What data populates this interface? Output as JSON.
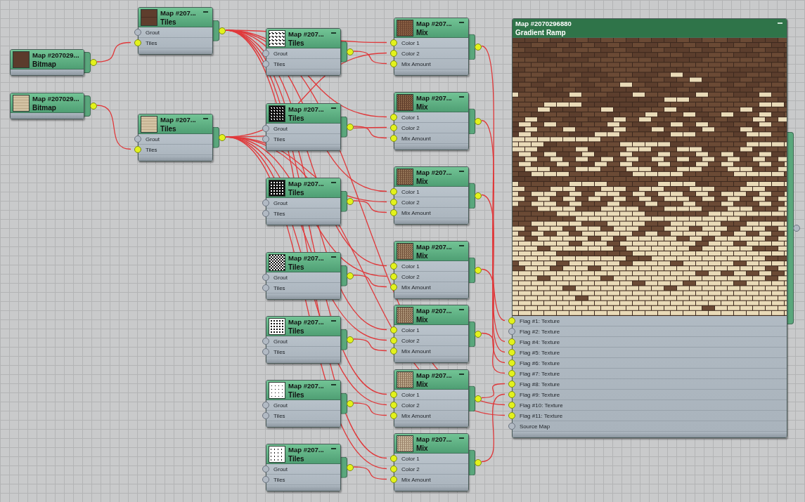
{
  "nodes": [
    {
      "kind": "bitmap",
      "title": "Map #207029...",
      "type": "Bitmap",
      "output_connected": true
    },
    {
      "kind": "bitmap",
      "title": "Map #207029...",
      "type": "Bitmap",
      "output_connected": true
    },
    {
      "kind": "tiles",
      "title": "Map #207...",
      "type": "Tiles",
      "inputs": [
        {
          "label": "Grout",
          "connected": false
        },
        {
          "label": "Tiles",
          "connected": true
        }
      ],
      "output_connected": true
    },
    {
      "kind": "tiles",
      "title": "Map #207...",
      "type": "Tiles",
      "inputs": [
        {
          "label": "Grout",
          "connected": false
        },
        {
          "label": "Tiles",
          "connected": true
        }
      ],
      "output_connected": true
    },
    {
      "kind": "tiles",
      "title": "Map #207...",
      "type": "Tiles",
      "inputs": [
        {
          "label": "Grout",
          "connected": false
        },
        {
          "label": "Tiles",
          "connected": false
        }
      ],
      "output_connected": true
    },
    {
      "kind": "tiles",
      "title": "Map #207...",
      "type": "Tiles",
      "inputs": [
        {
          "label": "Grout",
          "connected": false
        },
        {
          "label": "Tiles",
          "connected": false
        }
      ],
      "output_connected": true
    },
    {
      "kind": "tiles",
      "title": "Map #207...",
      "type": "Tiles",
      "inputs": [
        {
          "label": "Grout",
          "connected": false
        },
        {
          "label": "Tiles",
          "connected": false
        }
      ],
      "output_connected": true
    },
    {
      "kind": "tiles",
      "title": "Map #207...",
      "type": "Tiles",
      "inputs": [
        {
          "label": "Grout",
          "connected": false
        },
        {
          "label": "Tiles",
          "connected": false
        }
      ],
      "output_connected": true
    },
    {
      "kind": "tiles",
      "title": "Map #207...",
      "type": "Tiles",
      "inputs": [
        {
          "label": "Grout",
          "connected": false
        },
        {
          "label": "Tiles",
          "connected": false
        }
      ],
      "output_connected": true
    },
    {
      "kind": "tiles",
      "title": "Map #207...",
      "type": "Tiles",
      "inputs": [
        {
          "label": "Grout",
          "connected": false
        },
        {
          "label": "Tiles",
          "connected": false
        }
      ],
      "output_connected": true
    },
    {
      "kind": "tiles",
      "title": "Map #207...",
      "type": "Tiles",
      "inputs": [
        {
          "label": "Grout",
          "connected": false
        },
        {
          "label": "Tiles",
          "connected": false
        }
      ],
      "output_connected": true
    },
    {
      "kind": "mix",
      "title": "Map #207...",
      "type": "Mix",
      "inputs": [
        {
          "label": "Color 1",
          "connected": true
        },
        {
          "label": "Color 2",
          "connected": true
        },
        {
          "label": "Mix Amount",
          "connected": true
        }
      ],
      "output_connected": true
    },
    {
      "kind": "mix",
      "title": "Map #207...",
      "type": "Mix",
      "inputs": [
        {
          "label": "Color 1",
          "connected": true
        },
        {
          "label": "Color 2",
          "connected": true
        },
        {
          "label": "Mix Amount",
          "connected": true
        }
      ],
      "output_connected": true
    },
    {
      "kind": "mix",
      "title": "Map #207...",
      "type": "Mix",
      "inputs": [
        {
          "label": "Color 1",
          "connected": true
        },
        {
          "label": "Color 2",
          "connected": true
        },
        {
          "label": "Mix Amount",
          "connected": true
        }
      ],
      "output_connected": true
    },
    {
      "kind": "mix",
      "title": "Map #207...",
      "type": "Mix",
      "inputs": [
        {
          "label": "Color 1",
          "connected": true
        },
        {
          "label": "Color 2",
          "connected": true
        },
        {
          "label": "Mix Amount",
          "connected": true
        }
      ],
      "output_connected": true
    },
    {
      "kind": "mix",
      "title": "Map #207...",
      "type": "Mix",
      "inputs": [
        {
          "label": "Color 1",
          "connected": true
        },
        {
          "label": "Color 2",
          "connected": true
        },
        {
          "label": "Mix Amount",
          "connected": true
        }
      ],
      "output_connected": true
    },
    {
      "kind": "mix",
      "title": "Map #207...",
      "type": "Mix",
      "inputs": [
        {
          "label": "Color 1",
          "connected": true
        },
        {
          "label": "Color 2",
          "connected": true
        },
        {
          "label": "Mix Amount",
          "connected": true
        }
      ],
      "output_connected": true
    },
    {
      "kind": "mix",
      "title": "Map #207...",
      "type": "Mix",
      "inputs": [
        {
          "label": "Color 1",
          "connected": true
        },
        {
          "label": "Color 2",
          "connected": true
        },
        {
          "label": "Mix Amount",
          "connected": true
        }
      ],
      "output_connected": true
    },
    {
      "kind": "gradient_ramp",
      "title": "Map #2070296880",
      "type": "Gradient Ramp",
      "inputs": [
        {
          "label": "Flag #1: Texture",
          "connected": true
        },
        {
          "label": "Flag #2: Texture",
          "connected": false
        },
        {
          "label": "Flag #4: Texture",
          "connected": true
        },
        {
          "label": "Flag #5: Texture",
          "connected": true
        },
        {
          "label": "Flag #6: Texture",
          "connected": true
        },
        {
          "label": "Flag #7: Texture",
          "connected": true
        },
        {
          "label": "Flag #8: Texture",
          "connected": true
        },
        {
          "label": "Flag #9: Texture",
          "connected": true
        },
        {
          "label": "Flag #10: Texture",
          "connected": true
        },
        {
          "label": "Flag #11: Texture",
          "connected": true
        },
        {
          "label": "Source Map",
          "connected": false
        }
      ],
      "output_connected": false
    }
  ]
}
